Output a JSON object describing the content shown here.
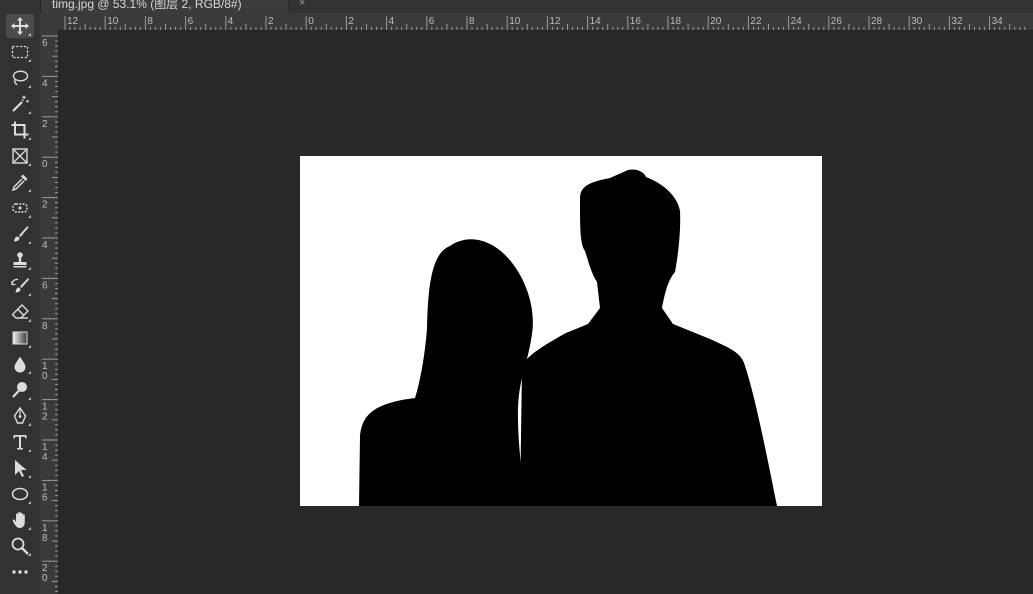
{
  "document": {
    "tab_title": "timg.jpg @ 53.1% (图层 2, RGB/8#)",
    "close_symbol": "×"
  },
  "toolbar": {
    "tools": [
      {
        "name": "move-tool",
        "icon": "move-icon",
        "active": true
      },
      {
        "name": "marquee-tool",
        "icon": "rectangular-marquee-icon"
      },
      {
        "name": "lasso-tool",
        "icon": "lasso-icon"
      },
      {
        "name": "magic-wand-tool",
        "icon": "magic-wand-icon"
      },
      {
        "name": "crop-tool",
        "icon": "crop-icon"
      },
      {
        "name": "frame-tool",
        "icon": "frame-icon"
      },
      {
        "name": "eyedropper-tool",
        "icon": "eyedropper-icon"
      },
      {
        "name": "healing-brush-tool",
        "icon": "healing-brush-icon"
      },
      {
        "name": "brush-tool",
        "icon": "brush-icon"
      },
      {
        "name": "clone-stamp-tool",
        "icon": "stamp-icon"
      },
      {
        "name": "history-brush-tool",
        "icon": "history-brush-icon"
      },
      {
        "name": "eraser-tool",
        "icon": "eraser-icon"
      },
      {
        "name": "gradient-tool",
        "icon": "gradient-icon"
      },
      {
        "name": "blur-tool",
        "icon": "blur-drop-icon"
      },
      {
        "name": "dodge-tool",
        "icon": "dodge-icon"
      },
      {
        "name": "pen-tool",
        "icon": "pen-icon"
      },
      {
        "name": "type-tool",
        "icon": "type-icon"
      },
      {
        "name": "path-selection-tool",
        "icon": "arrow-cursor-icon"
      },
      {
        "name": "ellipse-tool",
        "icon": "ellipse-icon"
      },
      {
        "name": "hand-tool",
        "icon": "hand-icon"
      },
      {
        "name": "zoom-tool",
        "icon": "zoom-icon"
      },
      {
        "name": "edit-toolbar",
        "icon": "more-icon"
      }
    ]
  },
  "rulers": {
    "horizontal_labels": [
      "12",
      "10",
      "8",
      "6",
      "4",
      "2",
      "0",
      "2",
      "4",
      "6",
      "8",
      "10",
      "12",
      "14",
      "16",
      "18",
      "20",
      "22",
      "24",
      "26",
      "28",
      "30",
      "32",
      "34"
    ],
    "vertical_labels": [
      "6",
      "4",
      "2",
      "0",
      "2",
      "4",
      "6",
      "8",
      "10",
      "12",
      "14",
      "16",
      "18",
      "20"
    ]
  },
  "colors": {
    "app_background": "#282828",
    "panel": "#323232",
    "ruler": "#3a3a3a",
    "canvas_white": "#ffffff",
    "silhouette": "#000000"
  }
}
